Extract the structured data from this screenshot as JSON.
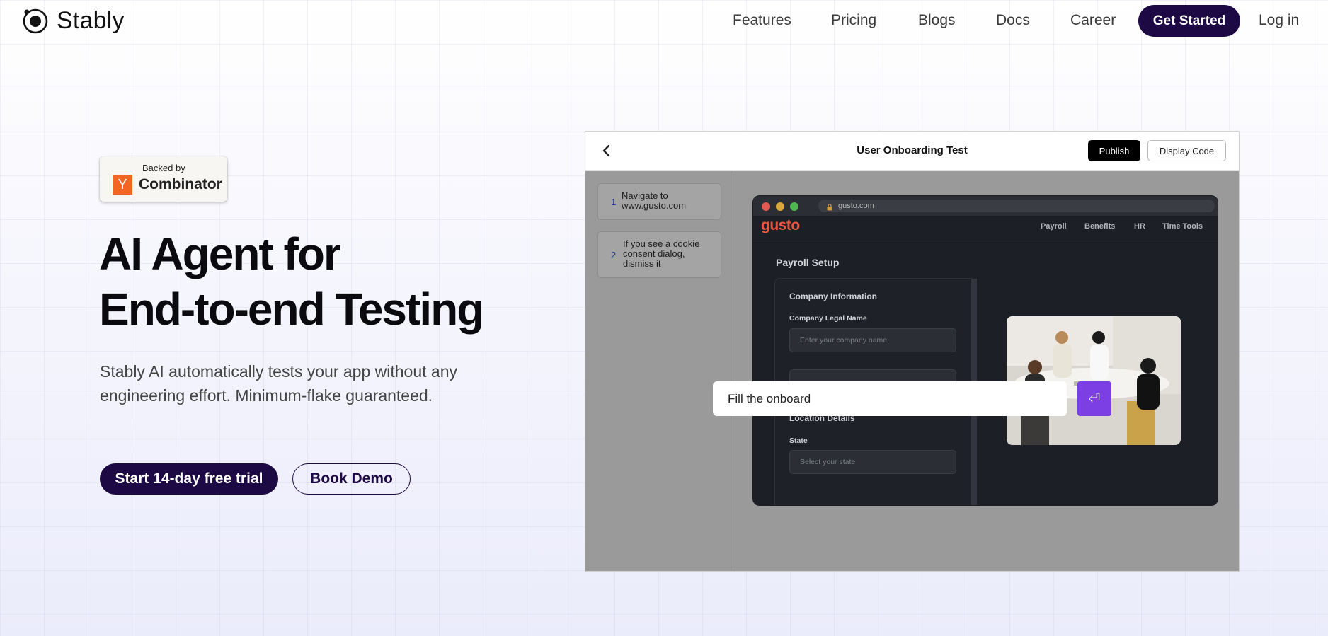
{
  "brand": {
    "name": "Stably",
    "logo_icon": "stably-orbit-icon"
  },
  "nav": {
    "links": [
      "Features",
      "Pricing",
      "Blogs",
      "Docs",
      "Career"
    ],
    "cta": "Get Started",
    "login": "Log in"
  },
  "badge": {
    "backed_by": "Backed by",
    "yc_letter": "Y",
    "yc_name": "Combinator",
    "colors": {
      "yc_orange": "#f26522"
    }
  },
  "hero": {
    "title_line1": "AI Agent for",
    "title_line2": "End-to-end Testing",
    "subtitle_line1": "Stably AI automatically tests your app without any",
    "subtitle_line2": "engineering effort. Minimum-flake guaranteed.",
    "primary_cta": "Start 14-day free trial",
    "secondary_cta": "Book Demo"
  },
  "demo": {
    "title": "User Onboarding Test",
    "publish": "Publish",
    "display_code": "Display Code",
    "steps": [
      {
        "num": "1",
        "text": "Navigate to www.gusto.com"
      },
      {
        "num": "2",
        "text": "If you see a cookie consent dialog, dismiss it"
      }
    ],
    "browser": {
      "url": "gusto.com",
      "app_logo": "gusto",
      "app_nav": [
        "Payroll",
        "Benefits",
        "HR",
        "Time Tools"
      ],
      "page_title": "Payroll Setup",
      "section1": "Company Information",
      "field1_label": "Company Legal Name",
      "field1_placeholder": "Enter your company name",
      "section2": "Location Details",
      "field2_label": "State",
      "field2_placeholder": "Select your state"
    },
    "prompt": {
      "value": "Fill the onboard",
      "submit_icon": "enter-key-icon",
      "submit_glyph": "⏎"
    }
  },
  "colors": {
    "primary": "#1d0a45",
    "accent_purple": "#7b3fe4",
    "gusto_orange": "#e8563f"
  }
}
